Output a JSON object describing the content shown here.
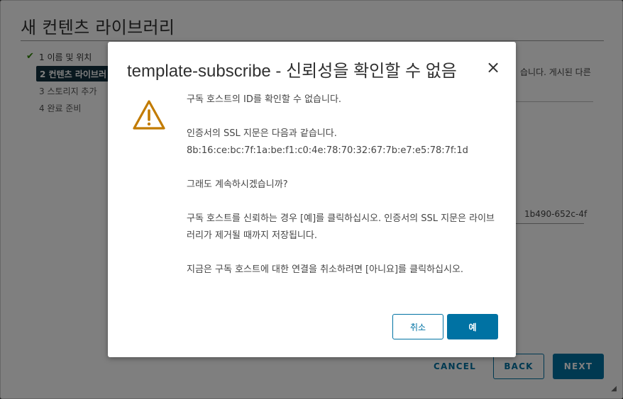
{
  "wizard": {
    "title": "새 컨텐츠 라이브러리",
    "steps": [
      {
        "label": "1 이름 및 위치"
      },
      {
        "label": "2 컨텐츠 라이브러"
      },
      {
        "label": "3 스토리지 추가"
      },
      {
        "label": "4 완료 준비"
      }
    ],
    "right_text": "습니다. 게시된 다른",
    "right_id": "1b490-652c-4f",
    "cancel_label": "CANCEL",
    "back_label": "BACK",
    "next_label": "NEXT"
  },
  "dialog": {
    "title": "template-subscribe - 신뢰성을 확인할 수 없음",
    "close_glyph": "×",
    "lines": {
      "p1": "구독 호스트의 ID를 확인할 수 없습니다.",
      "p2a": "인증서의 SSL 지문은 다음과 같습니다.",
      "p2b": "8b:16:ce:bc:7f:1a:be:f1:c0:4e:78:70:32:67:7b:e7:e5:78:7f:1d",
      "p3": "그래도 계속하시겠습니까?",
      "p4": "구독 호스트를 신뢰하는 경우 [예]를 클릭하십시오. 인증서의 SSL 지문은 라이브러리가 제거될 때까지 저장됩니다.",
      "p5": "지금은 구독 호스트에 대한 연결을 취소하려면 [아니요]를 클릭하십시오."
    },
    "cancel_label": "취소",
    "yes_label": "예"
  },
  "icons": {
    "warning": "warning-icon",
    "close": "close-icon",
    "check": "check-icon",
    "resize": "resize-grip-icon"
  },
  "colors": {
    "primary": "#0072a3",
    "warning": "#c27b00",
    "step_active_bg": "#13313f",
    "check": "#2e8500"
  }
}
